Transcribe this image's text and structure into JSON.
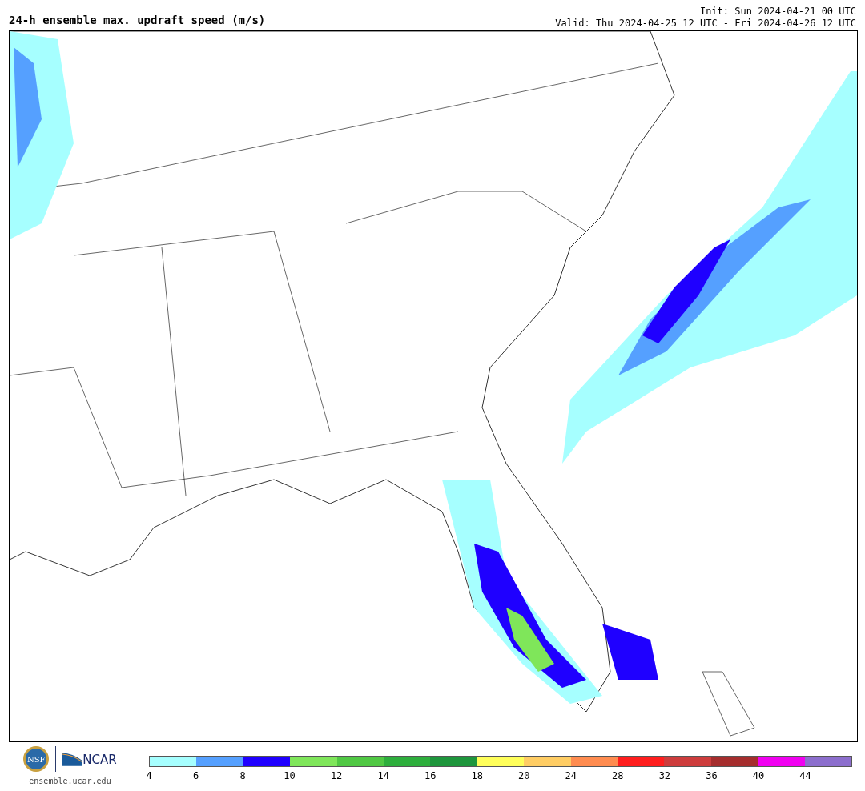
{
  "header": {
    "title": "24-h ensemble max. updraft speed (m/s)",
    "init": "Init: Sun 2024-04-21 00 UTC",
    "valid": "Valid: Thu 2024-04-25 12 UTC - Fri 2024-04-26 12 UTC"
  },
  "footer": {
    "seal_text": "NSF",
    "logo_text": "NCAR",
    "site": "ensemble.ucar.edu"
  },
  "legend": {
    "bins": [
      {
        "color": "#a6ffff"
      },
      {
        "color": "#55a0ff"
      },
      {
        "color": "#1f00ff"
      },
      {
        "color": "#7fe65a"
      },
      {
        "color": "#50c843"
      },
      {
        "color": "#2dae3c"
      },
      {
        "color": "#1e963c"
      },
      {
        "color": "#ffff5a"
      },
      {
        "color": "#ffcd64"
      },
      {
        "color": "#ff8c50"
      },
      {
        "color": "#ff1e1e"
      },
      {
        "color": "#cd3c3c"
      },
      {
        "color": "#a52d2d"
      },
      {
        "color": "#f000f0"
      },
      {
        "color": "#8c6ecd"
      }
    ],
    "ticks": [
      "4",
      "6",
      "8",
      "10",
      "12",
      "14",
      "16",
      "18",
      "20",
      "24",
      "28",
      "32",
      "36",
      "40",
      "44"
    ]
  }
}
